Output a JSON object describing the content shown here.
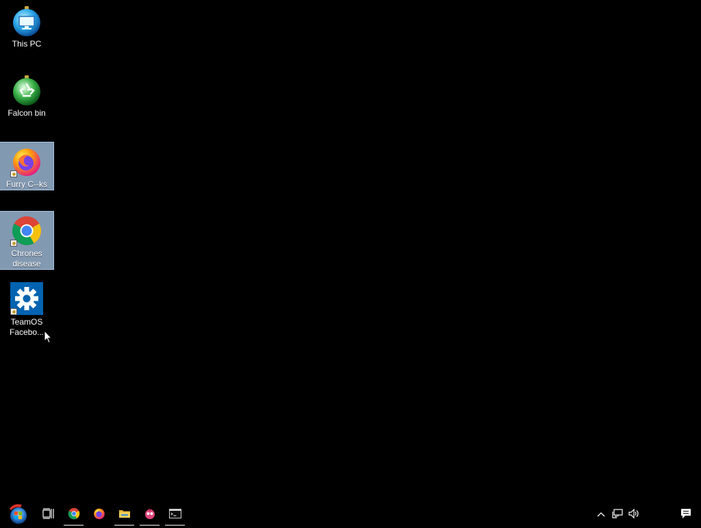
{
  "desktop": {
    "background": "#000000",
    "icons": [
      {
        "label": "This PC",
        "icon": "this-pc-icon",
        "selected": false
      },
      {
        "label": "Falcon bin",
        "icon": "recycle-bin-icon",
        "selected": false
      },
      {
        "label": "Furry C--ks",
        "icon": "firefox-icon",
        "selected": true
      },
      {
        "label": "Chrones disease",
        "icon": "chrome-icon",
        "selected": true
      },
      {
        "label": "TeamOS Facebo...",
        "icon": "settings-gear-icon",
        "selected": false
      }
    ]
  },
  "taskbar": {
    "start": {
      "icon": "start-orb-icon"
    },
    "pinned": [
      {
        "name": "task-view",
        "icon": "task-view-icon",
        "running": false
      },
      {
        "name": "chrome",
        "icon": "chrome-icon",
        "running": true
      },
      {
        "name": "firefox",
        "icon": "firefox-icon",
        "running": false
      },
      {
        "name": "file-explorer",
        "icon": "folder-icon",
        "running": true
      },
      {
        "name": "app",
        "icon": "app-icon",
        "running": true
      },
      {
        "name": "command-prompt",
        "icon": "cmd-icon",
        "running": true
      }
    ],
    "tray": [
      {
        "name": "show-hidden",
        "icon": "chevron-up-icon"
      },
      {
        "name": "network",
        "icon": "network-icon"
      },
      {
        "name": "volume",
        "icon": "speaker-icon"
      },
      {
        "name": "action-center",
        "icon": "notification-icon"
      }
    ]
  },
  "colors": {
    "selection": "#99b4d1",
    "win_blue": "#0063b1"
  }
}
